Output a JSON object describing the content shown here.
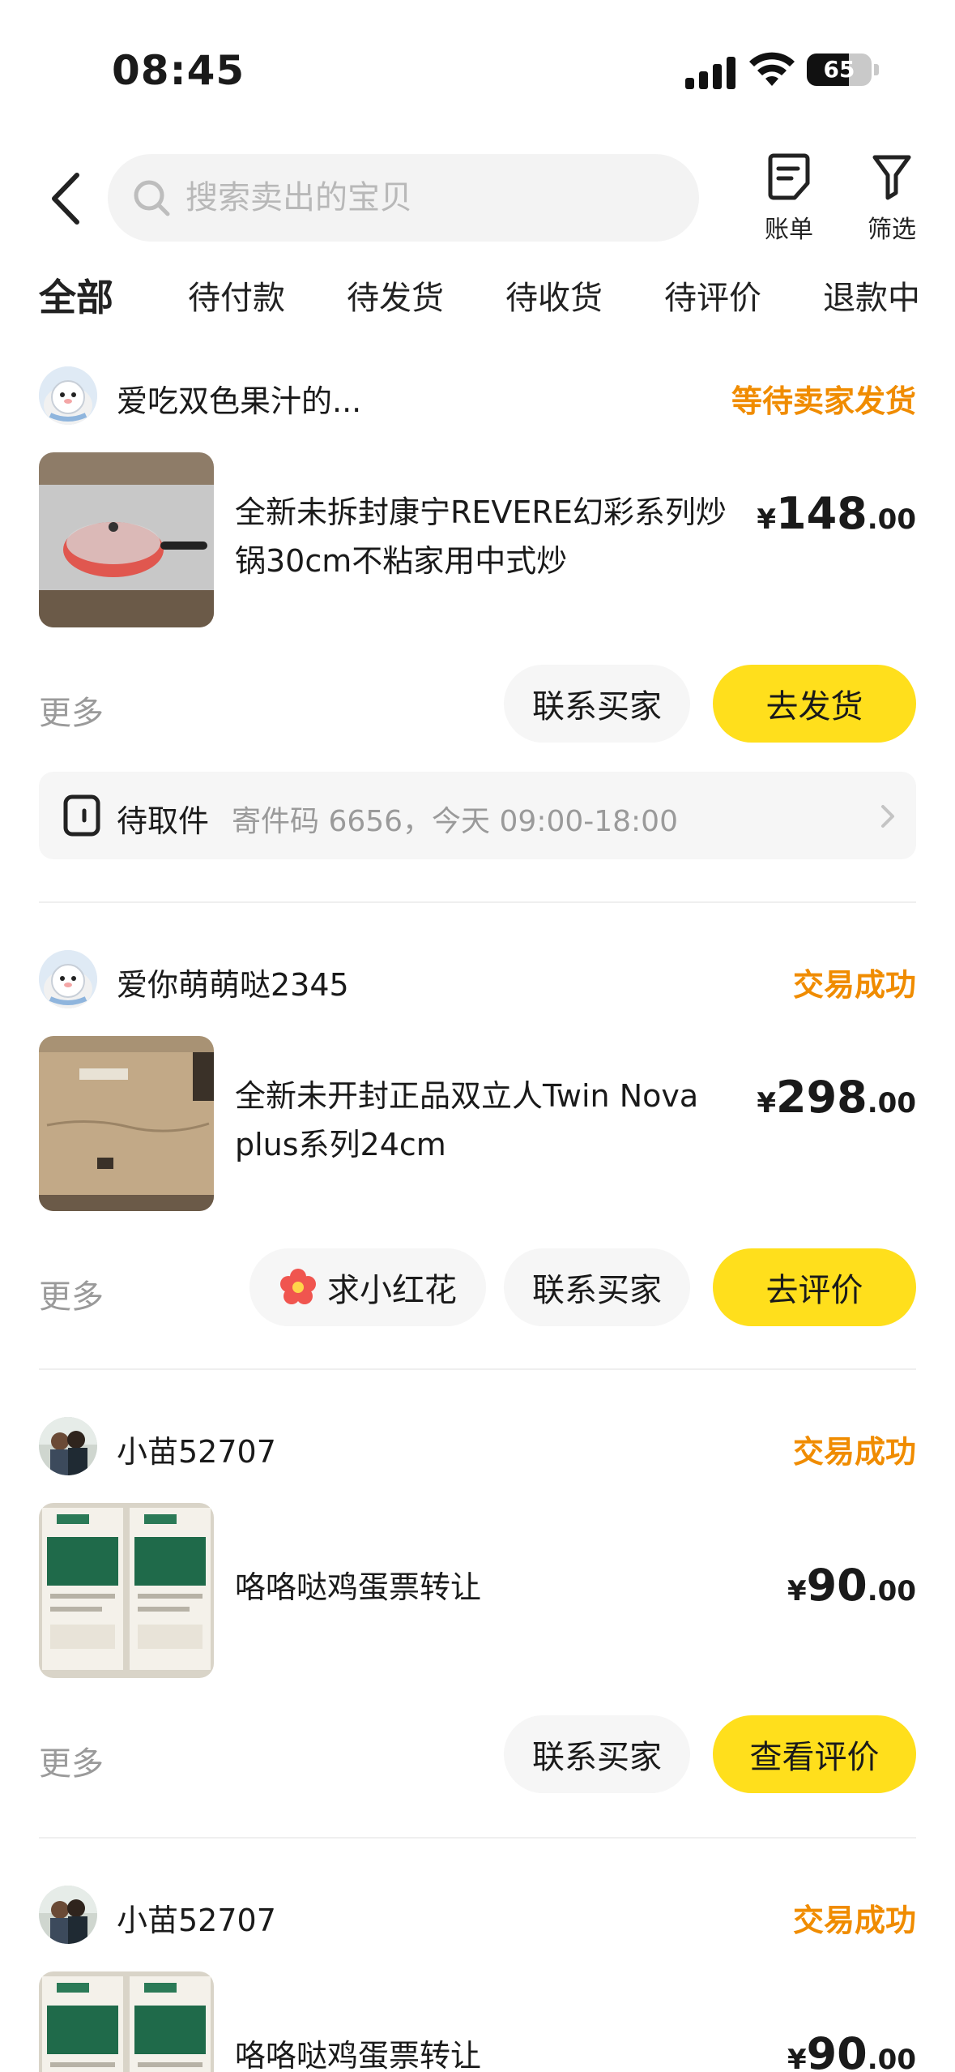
{
  "status_bar": {
    "time": "08:45",
    "battery": "65",
    "battery_level": 0.65
  },
  "header": {
    "search_placeholder": "搜索卖出的宝贝",
    "bill_label": "账单",
    "filter_label": "筛选"
  },
  "tabs": [
    {
      "label": "全部",
      "active": true
    },
    {
      "label": "待付款"
    },
    {
      "label": "待发货"
    },
    {
      "label": "待收货"
    },
    {
      "label": "待评价"
    },
    {
      "label": "退款中"
    }
  ],
  "orders": [
    {
      "buyer": "爱吃双色果汁的...",
      "status": "等待卖家发货",
      "title": "全新未拆封康宁REVERE幻彩系列炒锅30cm不粘家用中式炒",
      "price_currency": "¥",
      "price_int": "148",
      "price_dec": ".00",
      "more": "更多",
      "contact": "联系买家",
      "action": "去发货",
      "pickup_label": "待取件",
      "pickup_detail": "寄件码 6656，今天 09:00-18:00"
    },
    {
      "buyer": "爱你萌萌哒2345",
      "status": "交易成功",
      "title": "全新未开封正品双立人Twin Nova plus系列24cm",
      "price_currency": "¥",
      "price_int": "298",
      "price_dec": ".00",
      "more": "更多",
      "flower": "求小红花",
      "contact": "联系买家",
      "action": "去评价"
    },
    {
      "buyer": "小苗52707",
      "status": "交易成功",
      "title": "咯咯哒鸡蛋票转让",
      "price_currency": "¥",
      "price_int": "90",
      "price_dec": ".00",
      "more": "更多",
      "contact": "联系买家",
      "action": "查看评价"
    },
    {
      "buyer": "小苗52707",
      "status": "交易成功",
      "title": "咯咯哒鸡蛋票转让",
      "price_currency": "¥",
      "price_int": "90",
      "price_dec": ".00"
    }
  ],
  "colors": {
    "accent_yellow": "#ffdf1c",
    "status_orange": "#f08c00"
  }
}
